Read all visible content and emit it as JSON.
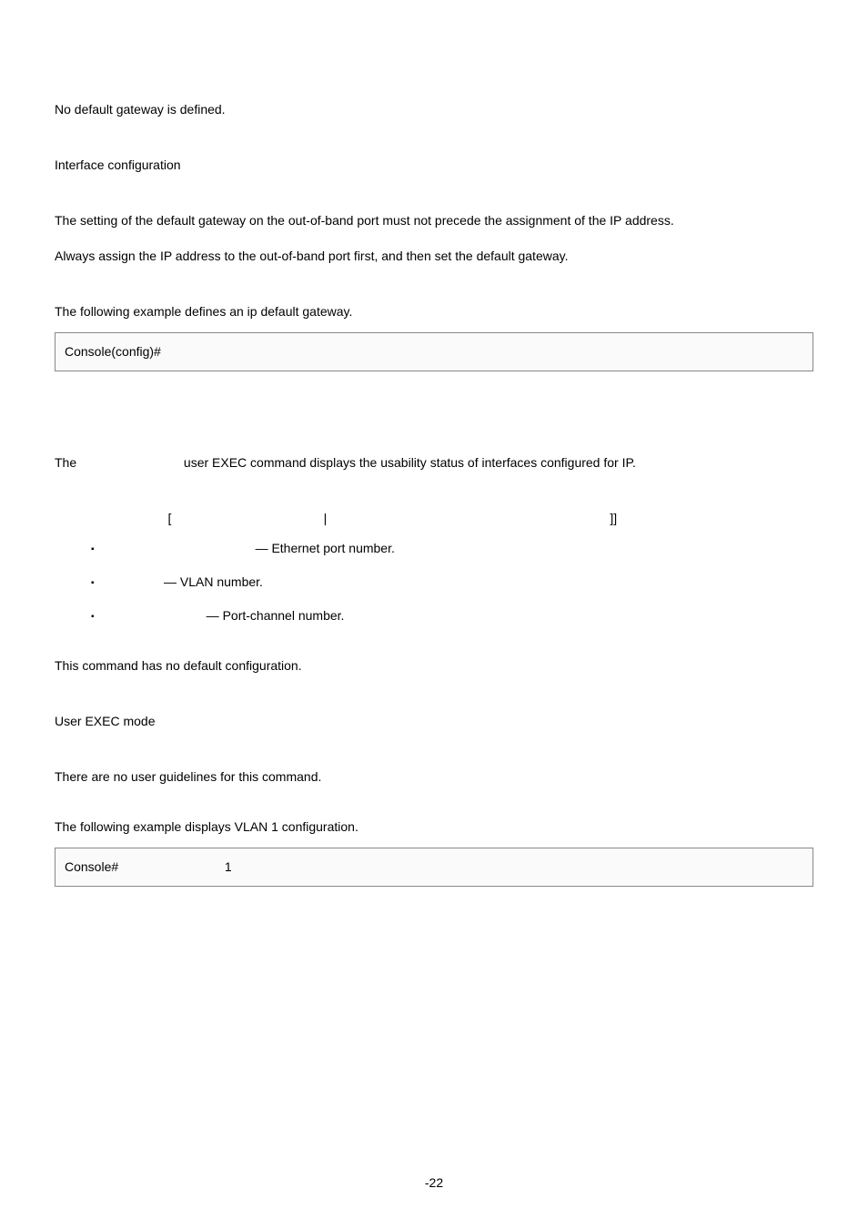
{
  "section1": {
    "no_default": "No default gateway is defined.",
    "iface_config": "Interface configuration",
    "setting_note": "The setting of the default gateway on the out-of-band port must not precede the assignment of the IP address.",
    "always_assign": "Always assign the IP address to the out-of-band port first, and then set the default gateway.",
    "example_intro": "The following example defines an ip default gateway.",
    "codebox1": "Console(config)# "
  },
  "section2": {
    "exec_the": "The ",
    "exec_rest": " user EXEC command displays the usability status of interfaces configured for IP.",
    "syntax_pre": "                                [                                           |                                                                                ]]",
    "param1": "             — Ethernet port number.",
    "param2": "— VLAN number.",
    "param3": "            — Port-channel number.",
    "no_default_config": "This command has no default configuration.",
    "user_exec_mode": "User EXEC mode",
    "no_guidelines": "There are no user guidelines for this command.",
    "example_vlan": "The following example displays VLAN 1 configuration.",
    "codebox2": "Console#                              1"
  },
  "footer": {
    "page": "-22"
  }
}
